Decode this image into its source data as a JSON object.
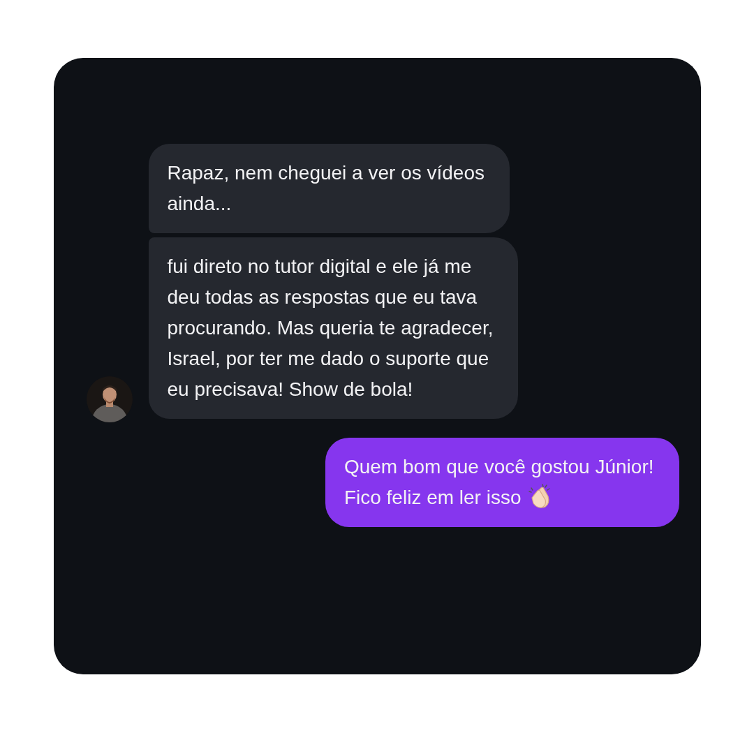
{
  "messages": [
    {
      "kind": "received",
      "lines": [
        "Rapaz, nem cheguei a ver os vídeos",
        "ainda..."
      ]
    },
    {
      "kind": "received",
      "lines": [
        "fui direto no tutor digital e ele já me",
        "deu todas as respostas que eu tava",
        "procurando. Mas queria te agradecer,",
        "Israel, por ter me dado o suporte que",
        "eu precisava! Show de bola!"
      ]
    },
    {
      "kind": "sent",
      "lines": [
        "Quem bom que você gostou Júnior!",
        "Fico feliz em ler isso"
      ]
    }
  ]
}
